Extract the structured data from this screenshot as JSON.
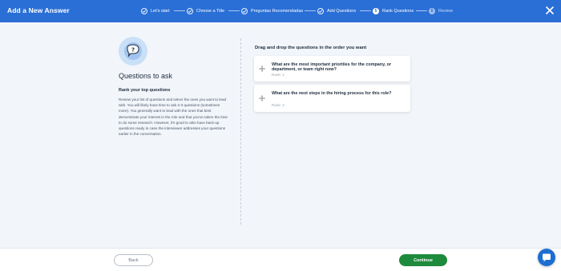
{
  "header": {
    "title": "Add a New Answer",
    "close_icon": "close-icon"
  },
  "stepper": {
    "steps": [
      {
        "label": "Let's start",
        "status": "done",
        "number": ""
      },
      {
        "label": "Choose a Title",
        "status": "done",
        "number": ""
      },
      {
        "label": "Preguntas Recomendadas",
        "status": "done",
        "number": ""
      },
      {
        "label": "Add Questions",
        "status": "done",
        "number": ""
      },
      {
        "label": "Rank Questions",
        "status": "current",
        "number": "5"
      },
      {
        "label": "Review",
        "status": "upcoming",
        "number": "6"
      }
    ]
  },
  "left": {
    "illustration_icon": "question-speech-bubble-icon",
    "title": "Questions to ask",
    "subtitle": "Rank your top questions",
    "body": "Review your list of questions and select the ones you want to lead with. You will likely have time to ask 2-3 questions (sometimes more). You generally want to lead with the ones that best demonstrate your interest in the role and that you've taken the time to do some research. However, it's good to also have back-up questions ready in case the interviewer addresses your questions earlier in the conversation."
  },
  "right": {
    "heading": "Drag and drop the questions in the order you want",
    "questions": [
      {
        "text": "What are the most important priorities for the company, or department, or team right now?",
        "rank": "Rank: 1"
      },
      {
        "text": "What are the next steps in the hiring process for this role?",
        "rank": "Rank: 2"
      }
    ]
  },
  "footer": {
    "back_label": "Back",
    "continue_label": "Continue"
  },
  "chat": {
    "icon": "chat-bubble-icon"
  },
  "colors": {
    "header_bg": "#2a6fd6",
    "content_bg": "#f2f5fa",
    "continue_bg": "#1e8a3b",
    "chat_bg": "#1c6fd1",
    "illustration_bg": "#c9e0f7"
  }
}
